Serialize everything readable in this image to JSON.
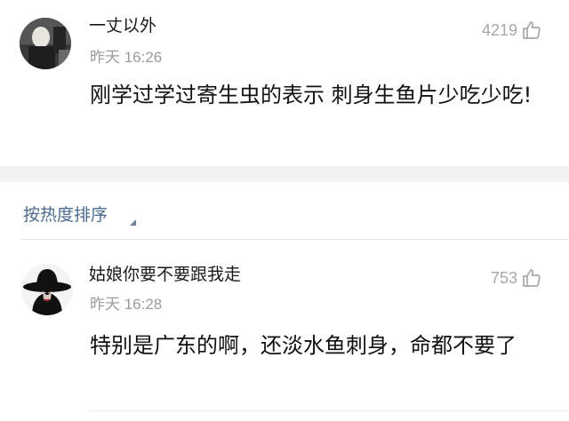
{
  "comments": [
    {
      "username": "一丈以外",
      "time": "昨天 16:26",
      "likes": "4219",
      "text": "刚学过学过寄生虫的表示 刺身生鱼片少吃少吃!",
      "avatar_icon": "dark-portrait-avatar-icon",
      "like_icon": "thumbs-up-outline-icon"
    },
    {
      "username": "姑娘你要不要跟我走",
      "time": "昨天 16:28",
      "likes": "753",
      "text": "特别是广东的啊，还淡水鱼刺身，命都不要了",
      "avatar_icon": "black-hat-woman-avatar-icon",
      "like_icon": "thumbs-up-outline-icon"
    }
  ],
  "sort": {
    "label": "按热度排序",
    "icon": "sort-corner-caret-icon"
  },
  "colors": {
    "link": "#4a6a8f",
    "muted": "#9b9b9b",
    "band": "#f2f2f2"
  }
}
